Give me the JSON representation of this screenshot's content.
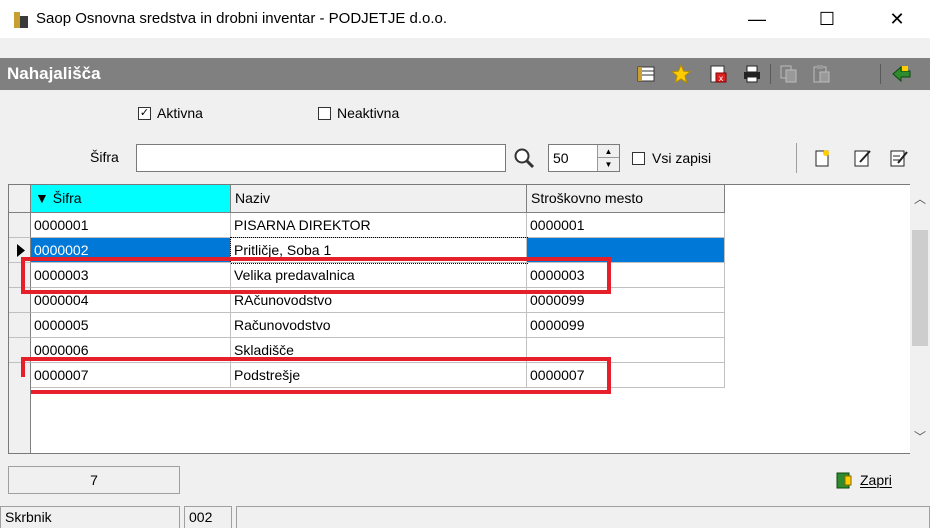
{
  "window": {
    "title": "Saop Osnovna sredstva in drobni inventar - PODJETJE d.o.o.",
    "minimize": "—",
    "maximize": "☐",
    "close": "✕"
  },
  "caption": {
    "title": "Nahajališča"
  },
  "filters": {
    "active_label": "Aktivna",
    "active_checked": "✓",
    "inactive_label": "Neaktivna"
  },
  "search": {
    "label": "Šifra",
    "value": "",
    "limit": "50",
    "all_records_label": "Vsi zapisi"
  },
  "grid": {
    "columns": [
      "▼ Šifra",
      "Naziv",
      "Stroškovno mesto"
    ],
    "rows": [
      {
        "sifra": "0000001",
        "naziv": "PISARNA DIREKTOR",
        "mesto": "0000001"
      },
      {
        "sifra": "0000002",
        "naziv": "Pritličje, Soba 1",
        "mesto": ""
      },
      {
        "sifra": "0000003",
        "naziv": "Velika predavalnica",
        "mesto": "0000003"
      },
      {
        "sifra": "0000004",
        "naziv": "RAčunovodstvo",
        "mesto": "0000099"
      },
      {
        "sifra": "0000005",
        "naziv": "Računovodstvo",
        "mesto": "0000099"
      },
      {
        "sifra": "0000006",
        "naziv": "Skladišče",
        "mesto": ""
      },
      {
        "sifra": "0000007",
        "naziv": "Podstrešje",
        "mesto": "0000007"
      }
    ],
    "selected_row": 1,
    "highlighted_rows": [
      2,
      6
    ]
  },
  "footer": {
    "count": "7",
    "close_label": "Zapri"
  },
  "status": {
    "user": "Skrbnik",
    "code": "002"
  },
  "colors": {
    "selection": "#0078d7",
    "header_active": "#00ffff",
    "highlight": "#e5202a",
    "caption_bg": "#808080"
  }
}
